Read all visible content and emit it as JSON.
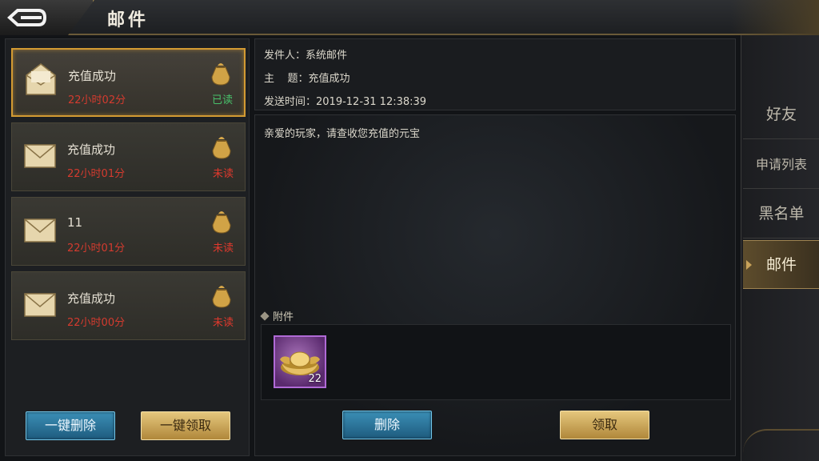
{
  "header": {
    "title": "邮件",
    "back_icon": "back-arrow-icon"
  },
  "mail_list": [
    {
      "title": "充值成功",
      "time": "22小时02分",
      "status": "已读",
      "status_kind": "read",
      "selected": true
    },
    {
      "title": "充值成功",
      "time": "22小时01分",
      "status": "未读",
      "status_kind": "unread",
      "selected": false
    },
    {
      "title": "11",
      "time": "22小时01分",
      "status": "未读",
      "status_kind": "unread",
      "selected": false
    },
    {
      "title": "充值成功",
      "time": "22小时00分",
      "status": "未读",
      "status_kind": "unread",
      "selected": false
    }
  ],
  "list_buttons": {
    "delete_all": "一键删除",
    "claim_all": "一键领取"
  },
  "detail": {
    "sender": "发件人：系统邮件",
    "subject": "主    题：充值成功",
    "send_time": "发送时间：2019-12-31 12:38:39",
    "body": "亲爱的玩家，请查收您充值的元宝",
    "attachment_label": "附件",
    "attachment_item": {
      "icon": "gold-ingot-icon",
      "count": "22"
    },
    "delete_button": "删除",
    "claim_button": "领取"
  },
  "tabs": [
    {
      "label": "好友",
      "active": false
    },
    {
      "label": "申请列表",
      "active": false
    },
    {
      "label": "黑名单",
      "active": false
    },
    {
      "label": "邮件",
      "active": true
    }
  ],
  "colors": {
    "accent_gold": "#d39a32",
    "read": "#48c06a",
    "unread": "#e0392d",
    "time_red": "#d43b2f"
  }
}
